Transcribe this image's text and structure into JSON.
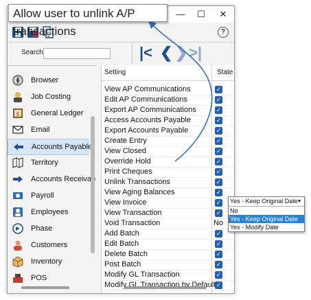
{
  "callout": {
    "text": "Allow user to unlink A/P transactions"
  },
  "titlebar": {
    "minimize": "—",
    "maximize": "☐",
    "close": "✕"
  },
  "toolbar": {
    "help": "?"
  },
  "search": {
    "label": "Search",
    "value": ""
  },
  "nav": {
    "first": "⏮",
    "prev": "❮",
    "next": "❯",
    "last": "⏭"
  },
  "sidebar": {
    "items": [
      {
        "label": "Browser",
        "icon": "browser-icon"
      },
      {
        "label": "Job Costing",
        "icon": "job-costing-icon"
      },
      {
        "label": "General Ledger",
        "icon": "general-ledger-icon"
      },
      {
        "label": "Email",
        "icon": "email-icon"
      },
      {
        "label": "Accounts Payable",
        "icon": "accounts-payable-icon",
        "active": true
      },
      {
        "label": "Territory",
        "icon": "territory-icon"
      },
      {
        "label": "Accounts Receivab",
        "icon": "accounts-receivable-icon"
      },
      {
        "label": "Payroll",
        "icon": "payroll-icon"
      },
      {
        "label": "Employees",
        "icon": "employees-icon"
      },
      {
        "label": "Phase",
        "icon": "phase-icon"
      },
      {
        "label": "Customers",
        "icon": "customers-icon"
      },
      {
        "label": "Inventory",
        "icon": "inventory-icon"
      },
      {
        "label": "POS",
        "icon": "pos-icon"
      }
    ]
  },
  "grid": {
    "headers": {
      "setting": "Setting",
      "state": "State"
    },
    "rows": [
      {
        "label": "View AP Communications",
        "checked": true
      },
      {
        "label": "Edit AP Communications",
        "checked": true
      },
      {
        "label": "Export AP Communications",
        "checked": true
      },
      {
        "label": "Access Accounts Payable",
        "checked": true
      },
      {
        "label": "Export Accounts Payable",
        "checked": true
      },
      {
        "label": "Create Entry",
        "checked": true
      },
      {
        "label": "View Closed",
        "checked": true
      },
      {
        "label": "Override Hold",
        "checked": true
      },
      {
        "label": "Print Cheques",
        "checked": true
      },
      {
        "label": "Unlink Transactions",
        "checked": true
      },
      {
        "label": "View Aging Balances",
        "checked": true
      },
      {
        "label": "View Invoice",
        "checked": true
      },
      {
        "label": "View Transaction",
        "checked": true
      },
      {
        "label": "Void Transaction",
        "state_text": "No"
      },
      {
        "label": "Add Batch",
        "checked": true
      },
      {
        "label": "Edit Batch",
        "checked": true
      },
      {
        "label": "Delete Batch",
        "checked": true
      },
      {
        "label": "Post Batch",
        "checked": true
      },
      {
        "label": "Modify GL Transaction",
        "checked": true
      },
      {
        "label": "Modify GL Transaction by Default",
        "checked": true
      }
    ]
  },
  "dropdown": {
    "selected": "Yes - Keep Original Date",
    "options": [
      "No",
      "Yes - Keep Original Date",
      "Yes - Modify Date"
    ],
    "highlighted_index": 1
  },
  "colors": {
    "accent": "#1e5fb8",
    "selection": "#2f7fd3",
    "arrow": "#2f6fb5"
  }
}
